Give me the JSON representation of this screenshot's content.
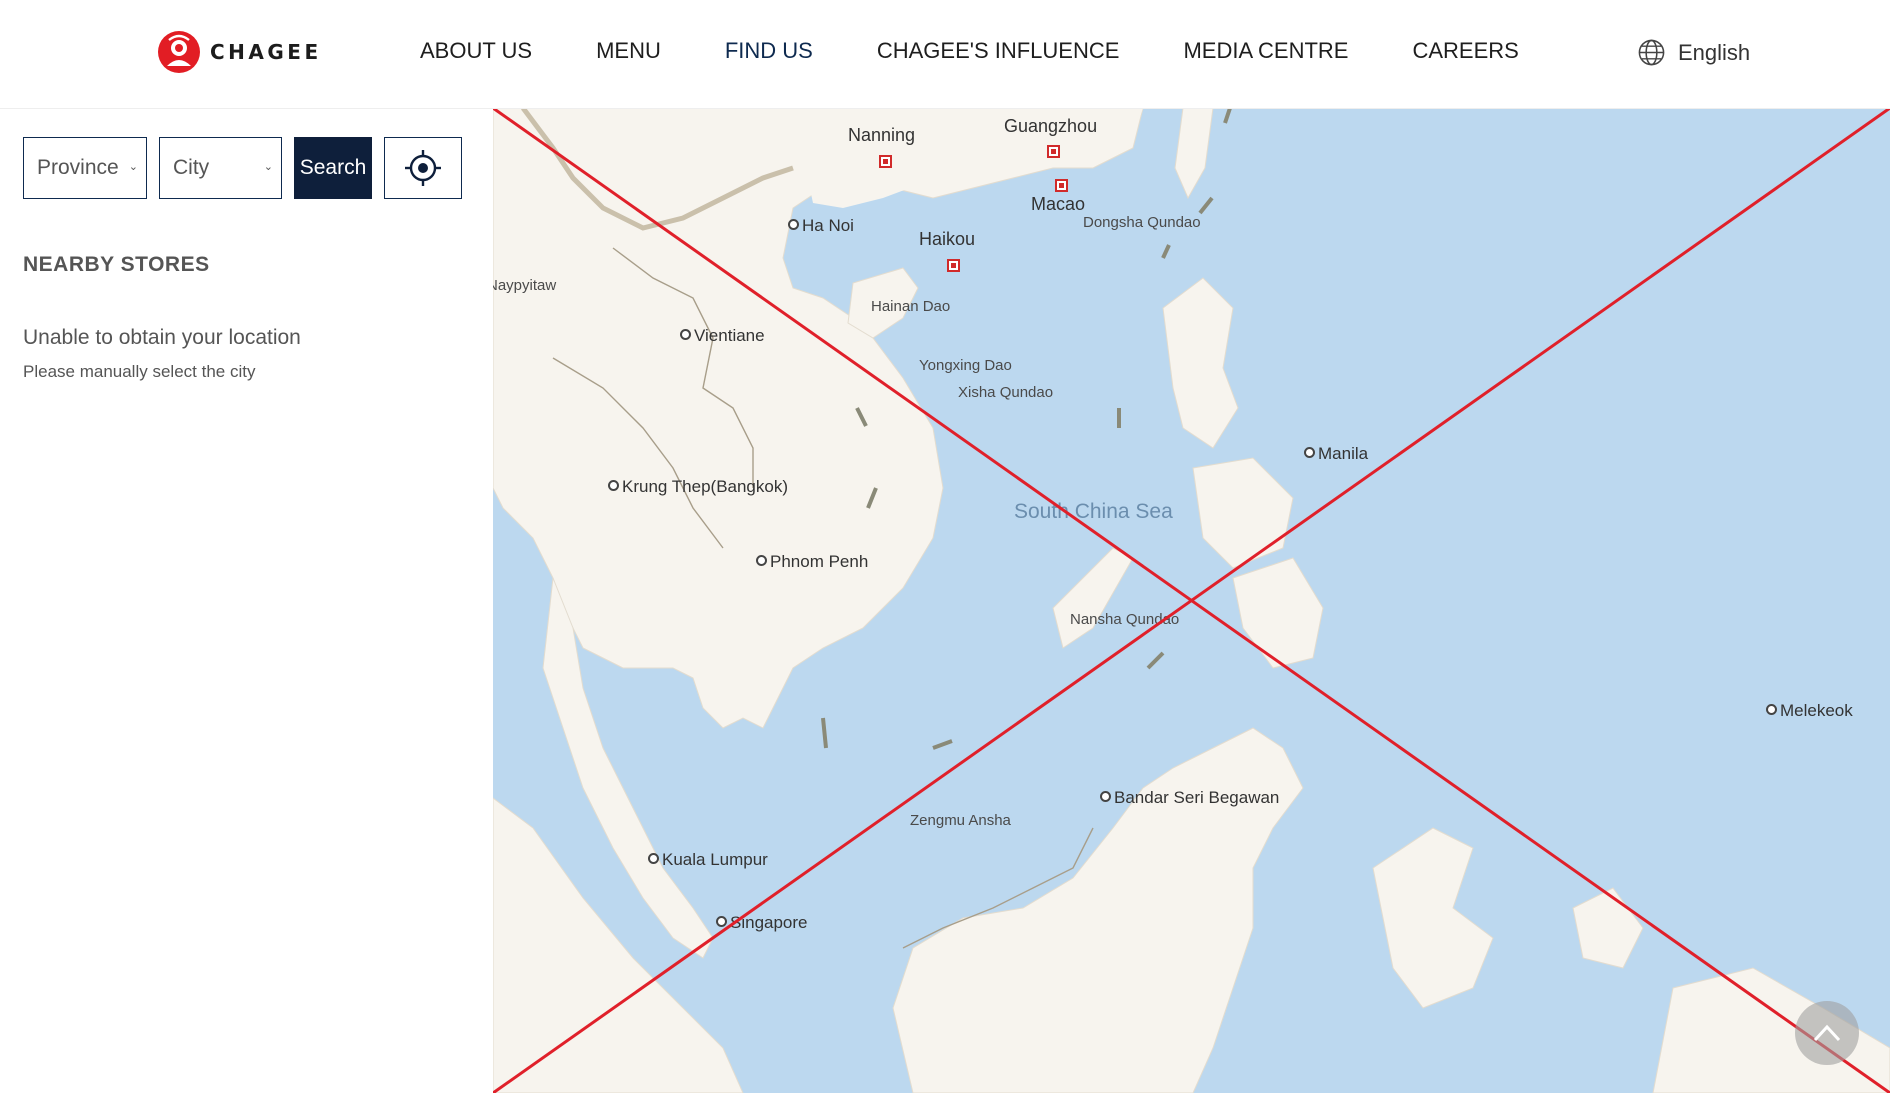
{
  "brand": {
    "name": "CHAGEE"
  },
  "nav": {
    "items": [
      {
        "label": "ABOUT US"
      },
      {
        "label": "MENU"
      },
      {
        "label": "FIND US"
      },
      {
        "label": "CHAGEE'S INFLUENCE"
      },
      {
        "label": "MEDIA CENTRE"
      },
      {
        "label": "CAREERS"
      }
    ],
    "active": "FIND US"
  },
  "language": {
    "label": "English",
    "icon": "globe-icon"
  },
  "search": {
    "province": "Province",
    "city": "City",
    "button_label": "Search",
    "locate_icon": "crosshair-icon"
  },
  "stores": {
    "title": "NEARBY STORES",
    "status": "Unable to obtain your location",
    "hint": "Please manually select the city"
  },
  "map": {
    "labels": {
      "nanning": "Nanning",
      "guangzhou": "Guangzhou",
      "macao": "Macao",
      "dongsha": "Dongsha Qundao",
      "hanoi": "Ha Noi",
      "haikou": "Haikou",
      "naypyitaw": "Naypyitaw",
      "hainan": "Hainan Dao",
      "vientiane": "Vientiane",
      "yongxing": "Yongxing Dao",
      "xisha": "Xisha Qundao",
      "manila": "Manila",
      "bangkok": "Krung Thep(Bangkok)",
      "scs": "South China Sea",
      "phnompenh": "Phnom Penh",
      "nansha": "Nansha Qundao",
      "melekeok": "Melekeok",
      "bandar": "Bandar Seri Begawan",
      "zengmu": "Zengmu Ansha",
      "kualalumpur": "Kuala Lumpur",
      "singapore": "Singapore"
    },
    "colors": {
      "sea": "#bcd8ef",
      "land": "#f7f4ee",
      "cross": "#e0202a"
    },
    "back_to_top_icon": "chevron-up-icon"
  },
  "colors": {
    "navy": "#0e1f3b",
    "brand_red": "#e02a2a"
  }
}
